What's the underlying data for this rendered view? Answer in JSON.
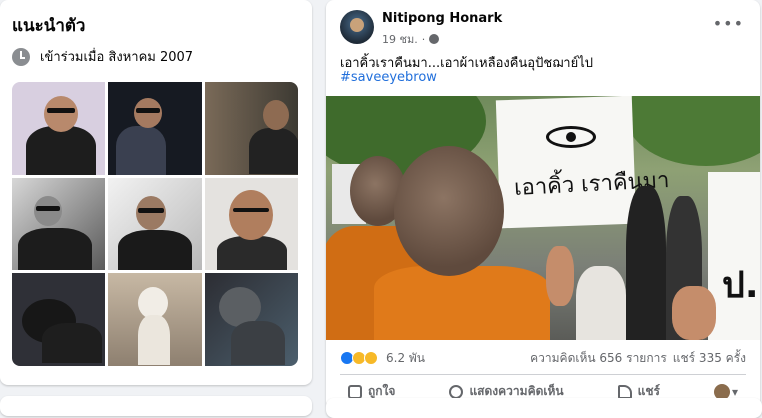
{
  "intro": {
    "title": "แนะนำตัว",
    "joined": "เข้าร่วมเมื่อ สิงหาคม 2007",
    "photos": [
      {
        "name": "photo-man-microphone"
      },
      {
        "name": "photo-man-piano"
      },
      {
        "name": "photo-man-dark-room"
      },
      {
        "name": "photo-man-bw"
      },
      {
        "name": "photo-man-sunglasses"
      },
      {
        "name": "photo-man-portrait"
      },
      {
        "name": "photo-dog-black"
      },
      {
        "name": "photo-dog-white"
      },
      {
        "name": "photo-dog-frenchie"
      }
    ]
  },
  "post": {
    "author": "Nitipong Honark",
    "time": "19 ชม.",
    "more": "•••",
    "caption": "เอาคิ้วเราคืนมา...เอาผ้าเหลืองคืนอุปัชฌาย์ไป",
    "hashtag": "#saveeyebrow",
    "image_sign_text": "เอาคิ้ว เราคืนมา",
    "image_sign_right_text": "ป.",
    "reactions_count": "6.2 พัน",
    "comments": "ความคิดเห็น 656 รายการ",
    "shares": "แชร์ 335 ครั้ง",
    "actions": {
      "like": "ถูกใจ",
      "comment": "แสดงความคิดเห็น",
      "share": "แชร์"
    }
  },
  "colors": {
    "link": "#216fdb",
    "like_reaction": "#1877f2",
    "haha_reaction": "#f7b928",
    "love_reaction": "#f33e58"
  }
}
